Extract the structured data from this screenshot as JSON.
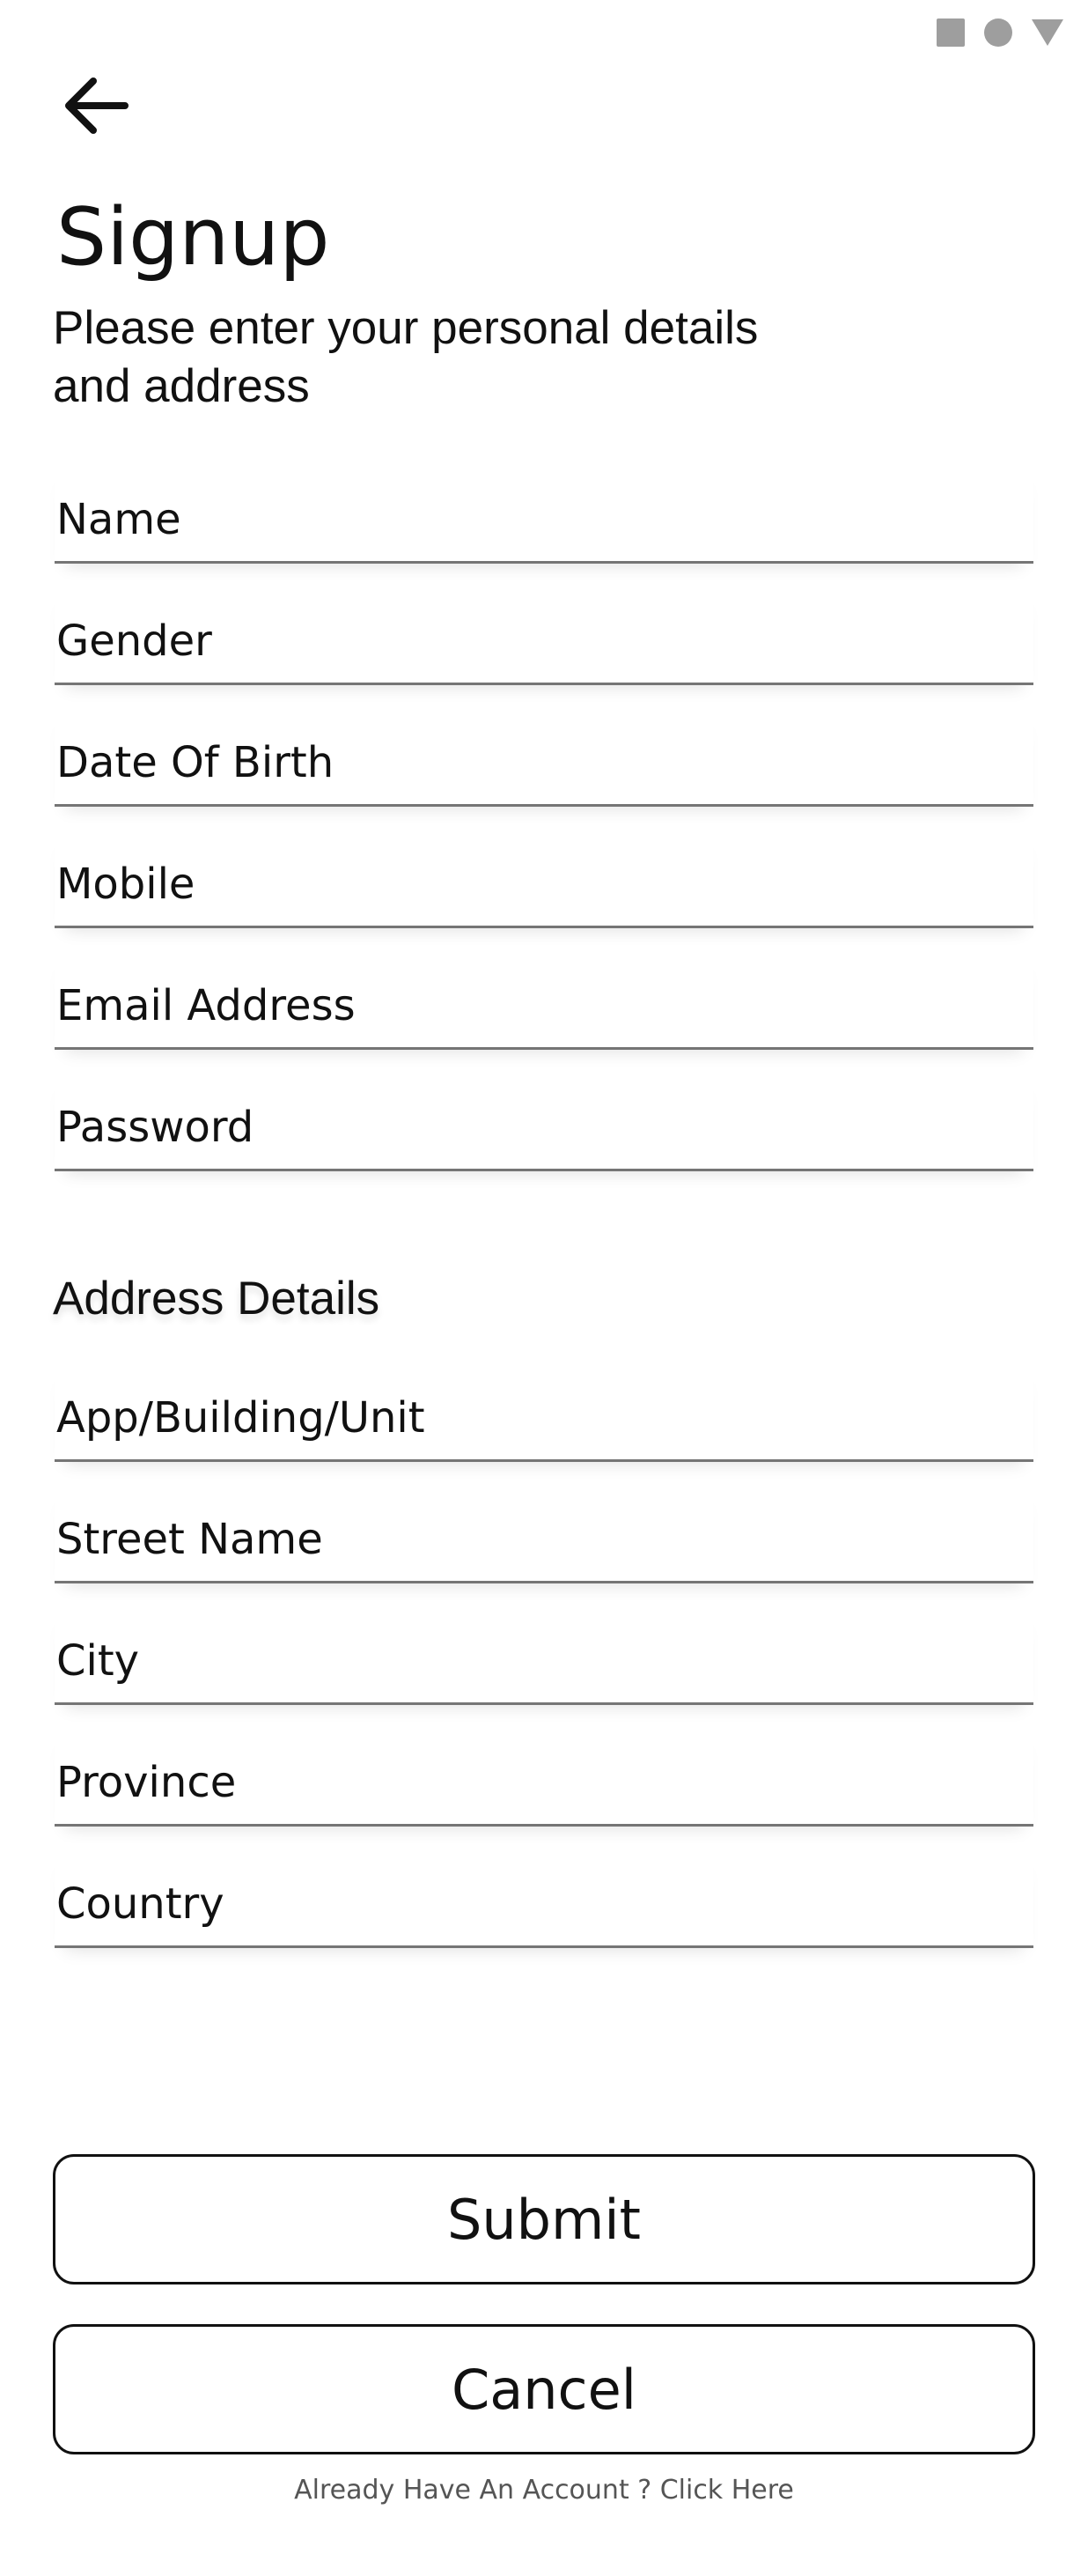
{
  "status_bar": {
    "icons": [
      "square-icon",
      "circle-icon",
      "triangle-icon"
    ],
    "icon_color": "#9e9e9e"
  },
  "header": {
    "back_icon": "arrow-left-icon",
    "title": "Signup",
    "subtitle": "Please enter your personal details and address"
  },
  "personal_fields": [
    {
      "placeholder": "Name",
      "value": ""
    },
    {
      "placeholder": "Gender",
      "value": ""
    },
    {
      "placeholder": "Date Of Birth",
      "value": ""
    },
    {
      "placeholder": "Mobile",
      "value": ""
    },
    {
      "placeholder": "Email Address",
      "value": ""
    },
    {
      "placeholder": "Password",
      "value": ""
    }
  ],
  "address": {
    "section_title": "Address Details",
    "fields": [
      {
        "placeholder": "App/Building/Unit",
        "value": ""
      },
      {
        "placeholder": "Street Name",
        "value": ""
      },
      {
        "placeholder": "City",
        "value": ""
      },
      {
        "placeholder": "Province",
        "value": ""
      },
      {
        "placeholder": "Country",
        "value": ""
      }
    ]
  },
  "actions": {
    "submit_label": "Submit",
    "cancel_label": "Cancel",
    "login_link": "Already Have An Account ? Click Here"
  },
  "colors": {
    "text": "#111111",
    "underline": "#757575",
    "background": "#ffffff"
  }
}
